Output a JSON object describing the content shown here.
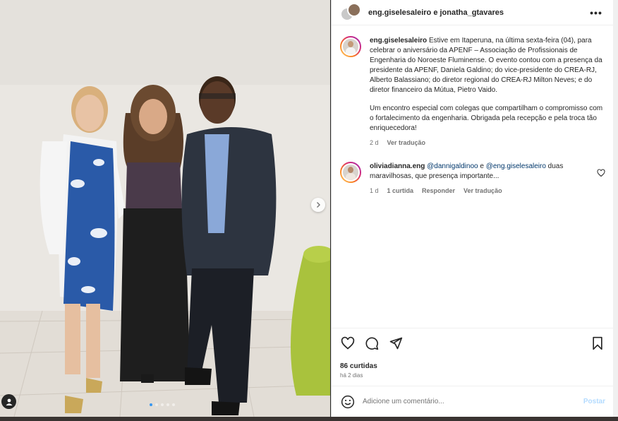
{
  "post": {
    "header_names": "eng.giselesaleiro e jonatha_gtavares",
    "more_label": "•••",
    "caption": {
      "username": "eng.giselesaleiro",
      "paragraph1": "Estive em Itaperuna, na última sexta-feira (04), para celebrar o aniversário da APENF – Associação de Profissionais de Engenharia do Noroeste Fluminense. O evento contou com a presença da presidente da APENF, Daniela Galdino; do vice-presidente do CREA-RJ, Alberto Balassiano; do diretor regional do CREA-RJ Milton Neves; e do diretor financeiro da Mútua, Pietro Vaido.",
      "paragraph2": "Um encontro especial com colegas que compartilham o compromisso com o fortalecimento da engenharia. Obrigada pela recepção e pela troca tão enriquecedora!",
      "time": "2 d",
      "translate": "Ver tradução"
    },
    "comment": {
      "username": "oliviadianna.eng",
      "mention1": "@dannigaldinoo",
      "conj": " e ",
      "mention2": "@eng.giselesaleiro",
      "text": " duas maravilhosas, que presença importante...",
      "time": "1 d",
      "likes": "1 curtida",
      "reply": "Responder",
      "translate": "Ver tradução"
    },
    "likes_count": "86 curtidas",
    "posted_ago": "há 2 dias",
    "add_comment_placeholder": "Adicione um comentário...",
    "post_button": "Postar"
  },
  "carousel": {
    "total": 5,
    "active_index": 0
  },
  "colors": {
    "accent": "#3797f0",
    "link": "#00376b",
    "post_disabled": "#b3dbff"
  },
  "icons": [
    "heart-icon",
    "comment-icon",
    "share-icon",
    "bookmark-icon",
    "emoji-icon",
    "user-tag-icon",
    "chevron-right-icon"
  ]
}
